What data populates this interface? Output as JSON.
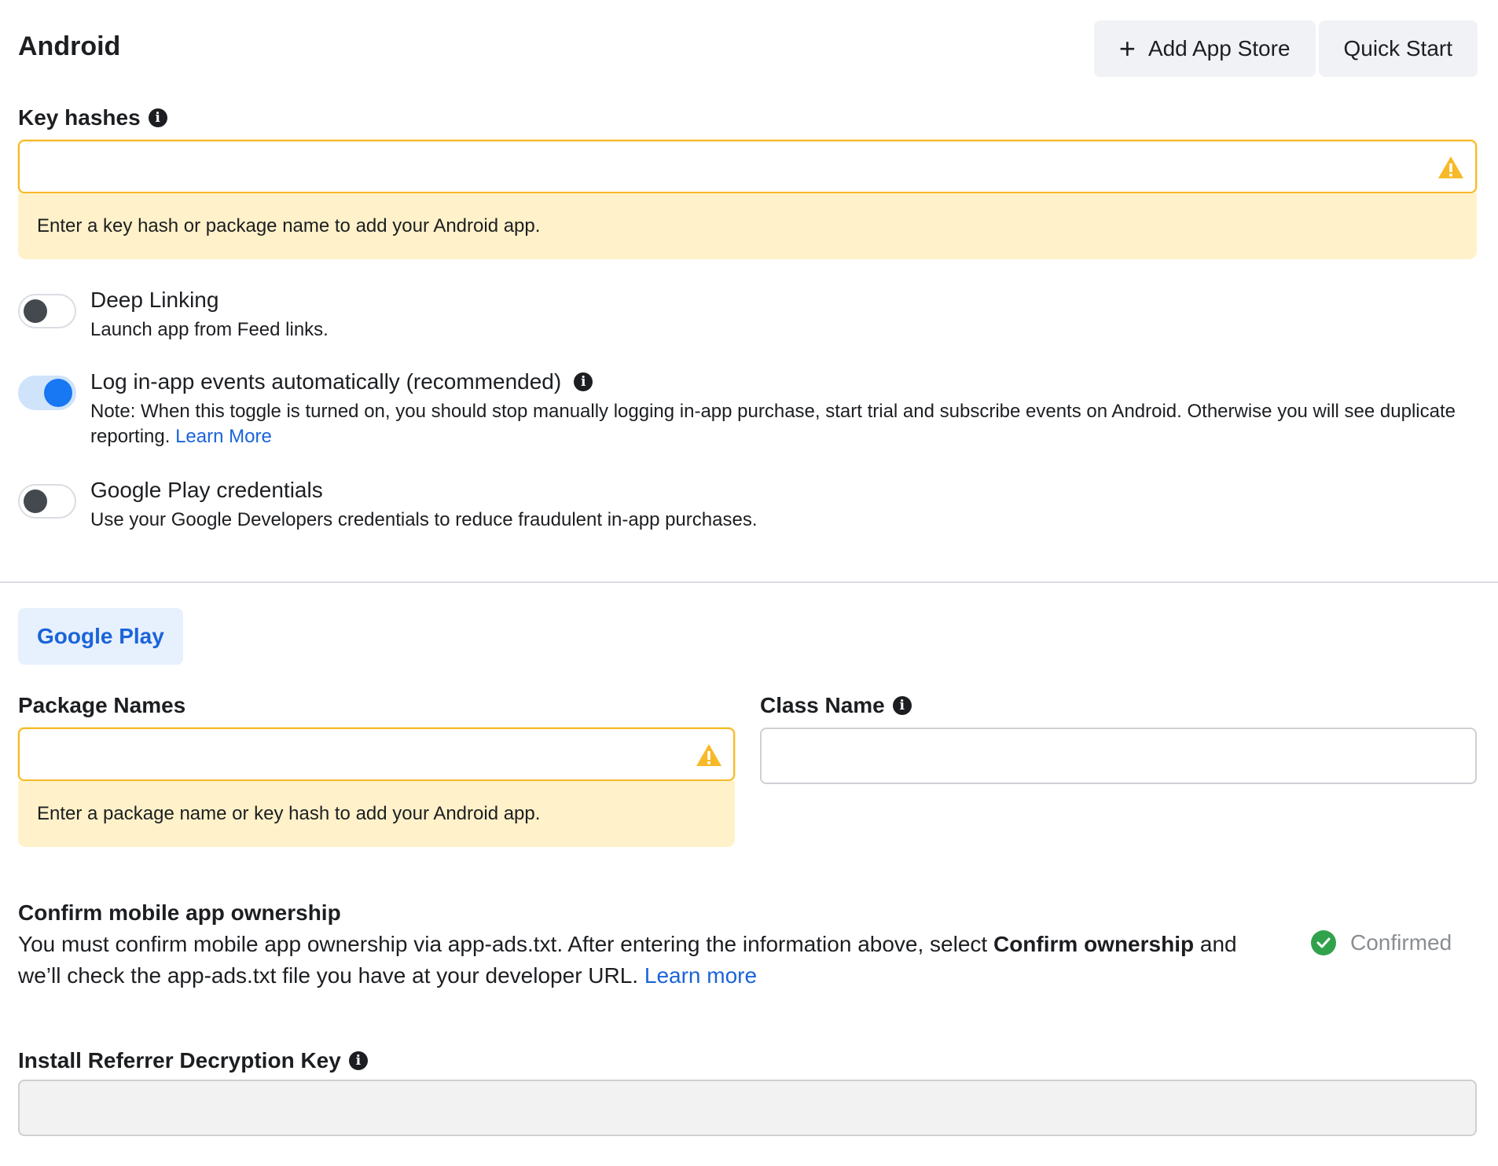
{
  "header": {
    "title": "Android",
    "add_app_store_label": "Add App Store",
    "quick_start_label": "Quick Start"
  },
  "key_hashes": {
    "label": "Key hashes",
    "value": "",
    "warning": "Enter a key hash or package name to add your Android app."
  },
  "toggles": [
    {
      "title": "Deep Linking",
      "description": "Launch app from Feed links.",
      "on": false
    },
    {
      "title": "Log in-app events automatically (recommended)",
      "description": "Note: When this toggle is turned on, you should stop manually logging in-app purchase, start trial and subscribe events on Android. Otherwise you will see duplicate reporting.",
      "link": "Learn More",
      "on": true
    },
    {
      "title": "Google Play credentials",
      "description": "Use your Google Developers credentials to reduce fraudulent in-app purchases.",
      "on": false
    }
  ],
  "store_tab": {
    "label": "Google Play"
  },
  "package_names": {
    "label": "Package Names",
    "value": "",
    "warning": "Enter a package name or key hash to add your Android app."
  },
  "class_name": {
    "label": "Class Name",
    "value": ""
  },
  "ownership": {
    "title": "Confirm mobile app ownership",
    "text_before": "You must confirm mobile app ownership via app-ads.txt. After entering the information above, select ",
    "text_bold": "Confirm ownership",
    "text_after": " and we’ll check the app-ads.txt file you have at your developer URL. ",
    "link": "Learn more",
    "status": "Confirmed"
  },
  "install_referrer": {
    "label": "Install Referrer Decryption Key",
    "value": ""
  },
  "colors": {
    "warning_border": "#f7b928",
    "warning_bg": "#fff1c9",
    "accent_blue": "#1877f2",
    "link_blue": "#1a64d8",
    "success_green": "#31a24c"
  }
}
